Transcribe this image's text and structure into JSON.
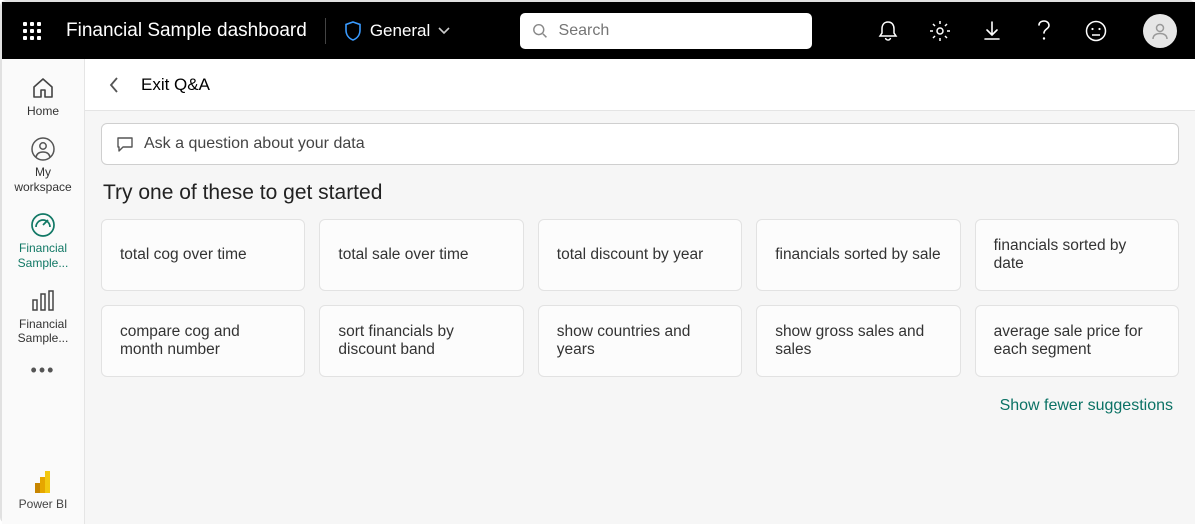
{
  "topbar": {
    "title": "Financial Sample dashboard",
    "sensitivity": "General",
    "search_placeholder": "Search"
  },
  "leftnav": {
    "home": "Home",
    "my_workspace": "My\nworkspace",
    "dashboard": "Financial Sample...",
    "report": "Financial Sample...",
    "powerbi": "Power BI"
  },
  "main": {
    "exit_label": "Exit Q&A",
    "ask_placeholder": "Ask a question about your data",
    "heading": "Try one of these to get started",
    "suggestions": [
      "total cog over time",
      "total sale over time",
      "total discount by year",
      "financials sorted by sale",
      "financials sorted by date",
      "compare cog and month number",
      "sort financials by discount band",
      "show countries and years",
      "show gross sales and sales",
      "average sale price for each segment"
    ],
    "show_fewer": "Show fewer suggestions"
  }
}
